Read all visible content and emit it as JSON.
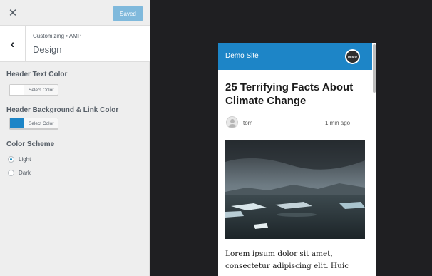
{
  "topbar": {
    "close_glyph": "✕",
    "saved_label": "Saved"
  },
  "panel": {
    "back_glyph": "‹",
    "breadcrumb": "Customizing • AMP",
    "title": "Design"
  },
  "sections": {
    "header_text_color": {
      "label": "Header Text Color",
      "button_label": "Select Color",
      "swatch_color": "#ffffff"
    },
    "header_bg_link_color": {
      "label": "Header Background & Link Color",
      "button_label": "Select Color",
      "swatch_color": "#1d85c7"
    },
    "color_scheme": {
      "label": "Color Scheme",
      "options": [
        {
          "label": "Light",
          "checked": true
        },
        {
          "label": "Dark",
          "checked": false
        }
      ]
    }
  },
  "preview": {
    "site_title": "Demo Site",
    "logo_text": "DEMO",
    "post_title": "25 Terrifying Facts About Climate Change",
    "author": "tom",
    "time": "1 min ago",
    "excerpt": "Lorem ipsum dolor sit amet, consectetur adipiscing elit. Huic",
    "header_color": "#1d85c7",
    "background_color": "#1f1f22"
  },
  "icons": {
    "close": "close-icon",
    "back": "chevron-left-icon",
    "avatar": "user-avatar-icon"
  }
}
